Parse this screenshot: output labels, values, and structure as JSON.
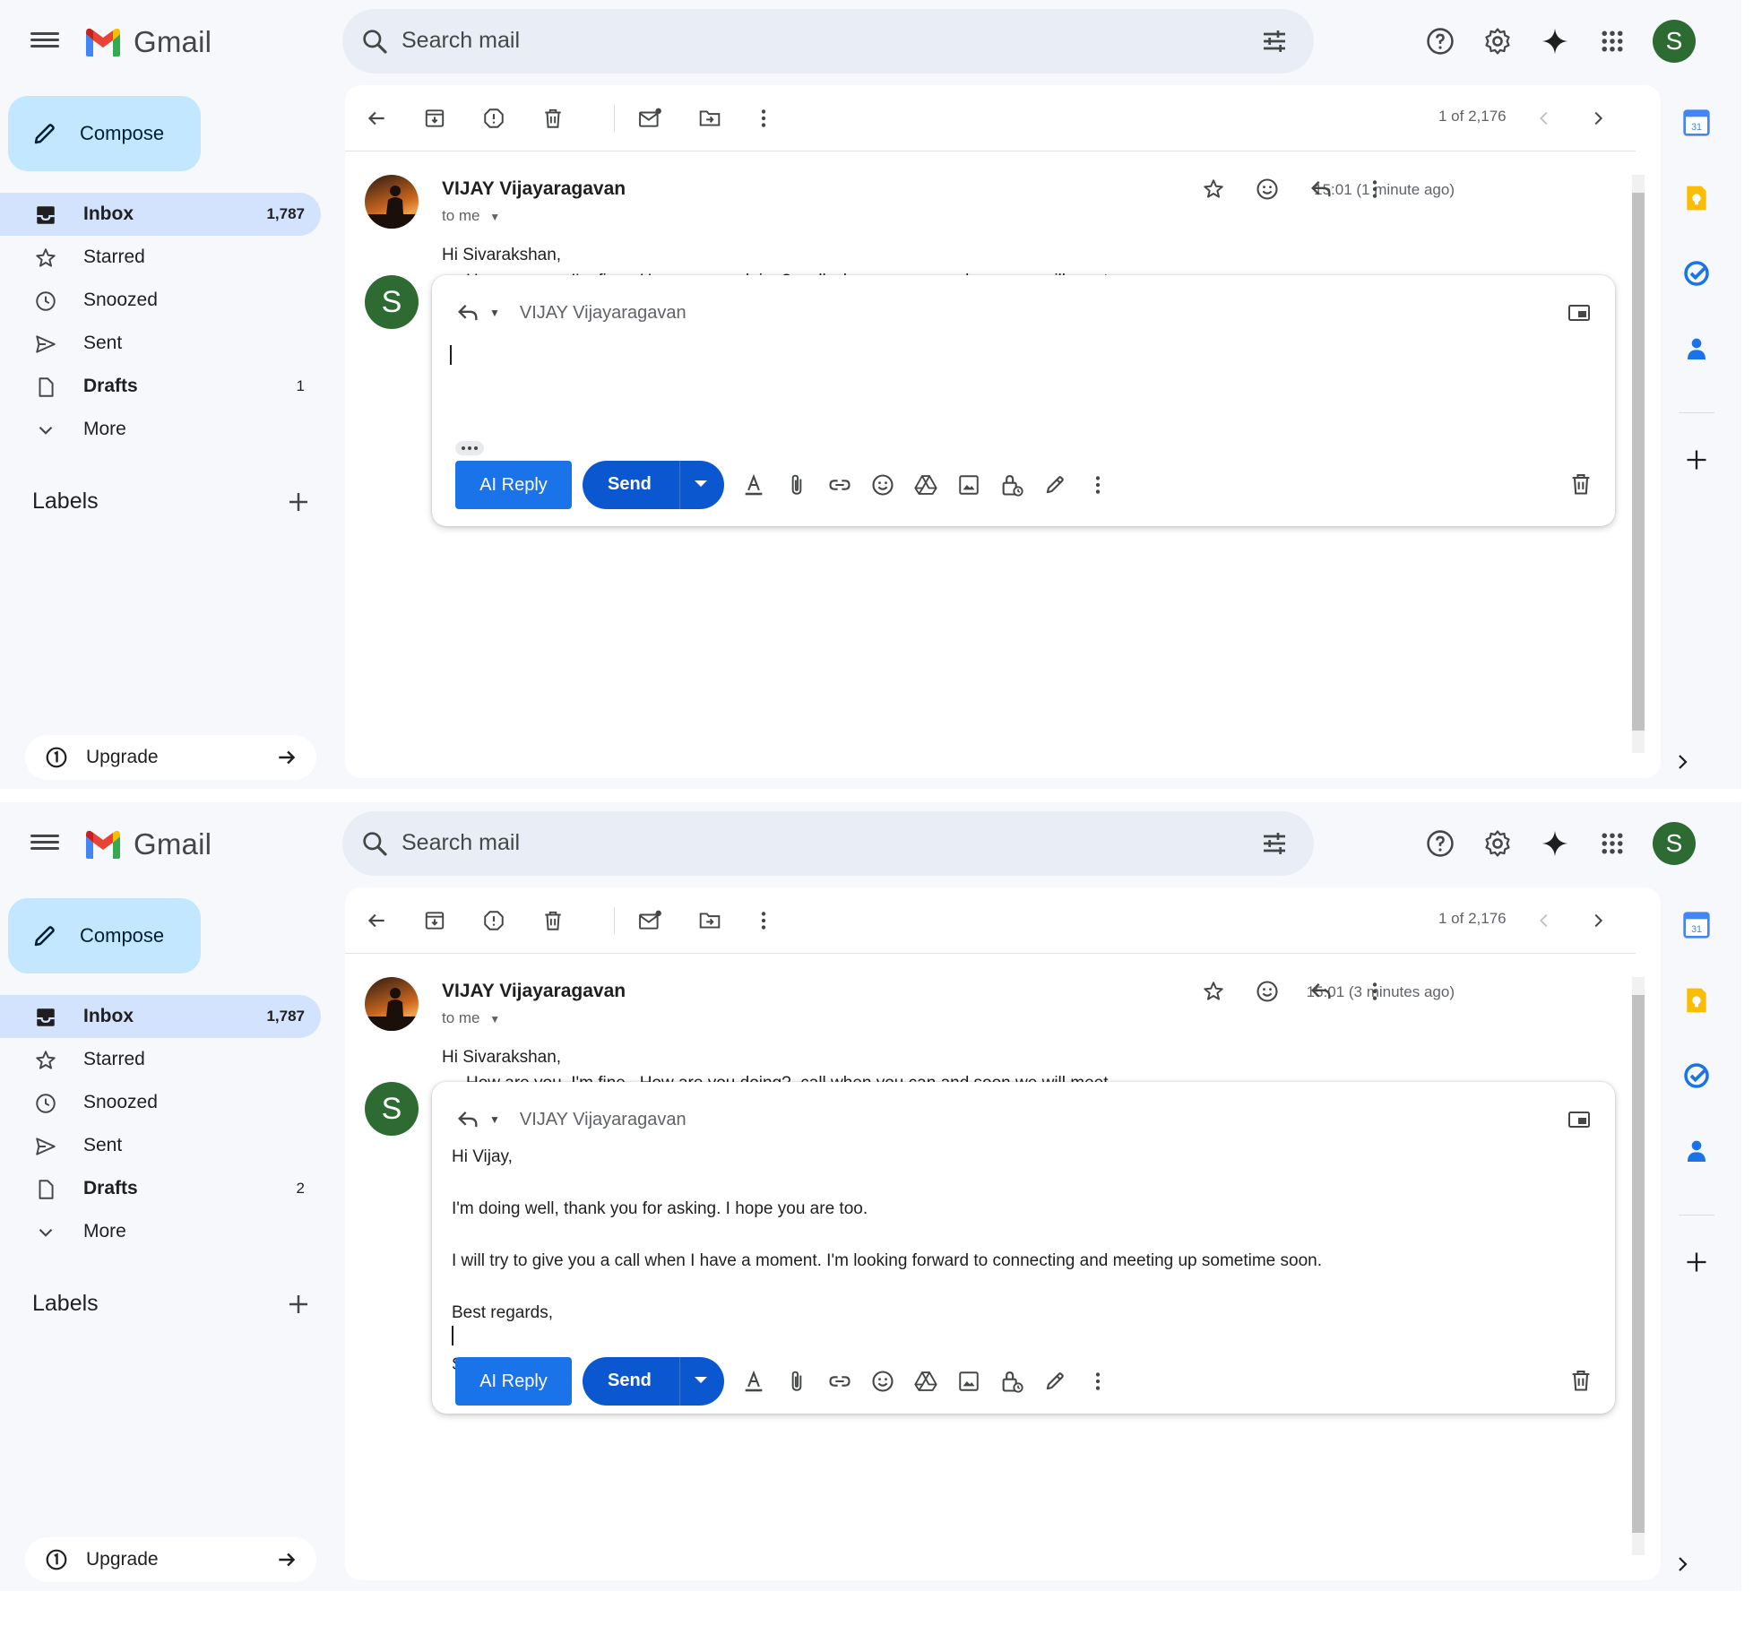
{
  "app": {
    "name": "Gmail"
  },
  "search": {
    "placeholder": "Search mail"
  },
  "account": {
    "initial": "S"
  },
  "compose": {
    "label": "Compose"
  },
  "nav": [
    {
      "label": "Inbox",
      "count": "1,787"
    },
    {
      "label": "Starred",
      "count": ""
    },
    {
      "label": "Snoozed",
      "count": ""
    },
    {
      "label": "Sent",
      "count": ""
    },
    {
      "label": "Drafts"
    },
    {
      "label": "More",
      "count": ""
    }
  ],
  "labels": {
    "title": "Labels"
  },
  "upgrade": {
    "label": "Upgrade"
  },
  "pager": {
    "text": "1 of 2,176"
  },
  "message": {
    "sender": "VIJAY Vijayaragavan",
    "to": "to me",
    "greeting": "Hi Sivarakshan,",
    "body": "How are you, I'm fine . How are you doing?, call when you can and soon we will meet"
  },
  "reply": {
    "to": "VIJAY Vijayaragavan",
    "ai_label": "AI Reply",
    "send_label": "Send"
  },
  "screens": [
    {
      "drafts_count": "1",
      "timestamp": "15:01 (1 minute ago)",
      "draft_lines": []
    },
    {
      "drafts_count": "2",
      "timestamp": "15:01 (3 minutes ago)",
      "draft_lines": [
        "Hi Vijay,",
        "I'm doing well, thank you for asking. I hope you are too.",
        "I will try to give you a call when I have a moment. I'm looking forward to connecting and meeting up sometime soon.",
        "Best regards,",
        "Sivarakshan"
      ]
    }
  ],
  "colors": {
    "accent": "#0b57d0",
    "ai_button": "#1a73e8",
    "compose_bg": "#c2e7ff",
    "nav_active": "#d3e3fd",
    "avatar_green": "#2e6b33"
  },
  "icons": [
    "hamburger-icon",
    "gmail-logo",
    "search-icon",
    "tune-icon",
    "help-icon",
    "settings-icon",
    "gemini-icon",
    "apps-icon",
    "pencil-icon",
    "inbox-icon",
    "star-icon",
    "clock-icon",
    "send-icon",
    "draft-icon",
    "chevron-down-icon",
    "plus-icon",
    "upgrade-icon",
    "arrow-right-icon",
    "back-arrow-icon",
    "archive-icon",
    "report-spam-icon",
    "trash-icon",
    "mark-unread-icon",
    "move-to-icon",
    "more-vert-icon",
    "chevron-left-icon",
    "chevron-right-icon",
    "emoji-icon",
    "reply-icon",
    "pop-out-icon",
    "text-format-icon",
    "attach-icon",
    "link-icon",
    "drive-icon",
    "photo-icon",
    "confidential-icon",
    "signature-icon",
    "calendar-icon",
    "keep-icon",
    "tasks-icon",
    "contacts-icon"
  ]
}
